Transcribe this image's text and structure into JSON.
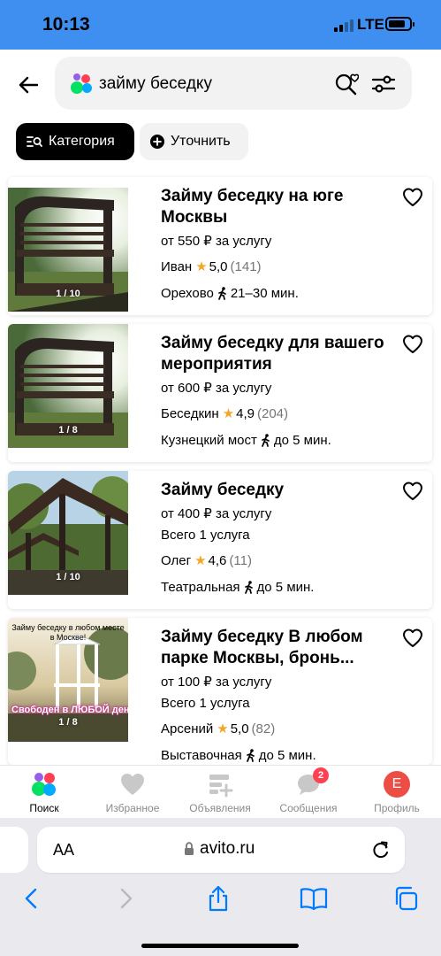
{
  "status_bar": {
    "time": "10:13",
    "network": "LTE",
    "signal_bars": 2,
    "battery_level": 0.8
  },
  "header": {
    "back_icon": "arrow-left-icon",
    "search_query": "займу беседку",
    "saved_search_icon": "search-heart-icon",
    "filters_icon": "sliders-icon"
  },
  "chips": {
    "category_label": "Категория",
    "category_icon": "list-search-icon",
    "refine_label": "Уточнить",
    "refine_icon": "plus-circle-icon"
  },
  "listings": [
    {
      "title": "Займу беседку на юге Москвы",
      "price": "от 550 ₽ за услугу",
      "seller": "Иван",
      "rating": "5,0",
      "reviews": "(141)",
      "location": "Орехово",
      "distance": "21–30 мин.",
      "photo_counter": "1 / 10"
    },
    {
      "title": "Займу беседку для вашего мероприятия",
      "price": "от 600 ₽ за услугу",
      "seller": "Беседкин",
      "rating": "4,9",
      "reviews": "(204)",
      "location": "Кузнецкий мост",
      "distance": "до 5 мин.",
      "photo_counter": "1 / 8"
    },
    {
      "title": "Займу беседку",
      "price": "от 400 ₽ за услугу",
      "services": "Всего 1 услуга",
      "seller": "Олег",
      "rating": "4,6",
      "reviews": "(11)",
      "location": "Театральная",
      "distance": "до 5 мин.",
      "photo_counter": "1 / 10"
    },
    {
      "title": "Займу беседку В любом парке Москвы, бронь...",
      "price": "от 100 ₽ за услугу",
      "services": "Всего 1 услуга",
      "seller": "Арсений",
      "rating": "5,0",
      "reviews": "(82)",
      "location": "Выставочная",
      "distance": "до 5 мин.",
      "photo_counter": "1 / 8",
      "photo_caption_top": "Займу беседку в любом месте в Москве!",
      "photo_caption_bottom": "Свободен в ЛЮБОЙ день!"
    }
  ],
  "tab_bar": [
    {
      "label": "Поиск",
      "icon": "avito-logo-icon",
      "active": true
    },
    {
      "label": "Избранное",
      "icon": "heart-icon"
    },
    {
      "label": "Объявления",
      "icon": "ads-add-icon"
    },
    {
      "label": "Сообщения",
      "icon": "chat-bubble-icon",
      "badge": "2"
    },
    {
      "label": "Профиль",
      "icon": "avatar-icon",
      "avatar_letter": "E"
    }
  ],
  "browser": {
    "aa_label": "AA",
    "url": "avito.ru",
    "toolbar_icons": [
      "back-chevron-icon",
      "forward-chevron-icon",
      "share-icon",
      "bookmarks-icon",
      "tabs-icon"
    ]
  },
  "colors": {
    "status_bar": "#3f8ff0",
    "star": "#f5a623",
    "badge": "#ff4053",
    "avatar": "#ec4e45",
    "ios_blue": "#007aff"
  }
}
